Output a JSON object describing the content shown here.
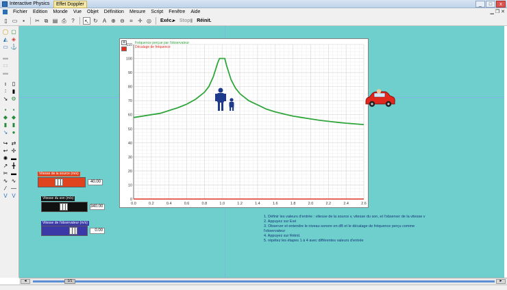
{
  "window": {
    "title": "Interactive Physics",
    "document": "Effet Doppler",
    "controls": [
      "_",
      "□",
      "x"
    ]
  },
  "menu": {
    "items": [
      "Fichier",
      "Edition",
      "Monde",
      "Vue",
      "Objet",
      "Définition",
      "Mesure",
      "Script",
      "Fenêtre",
      "Aide"
    ]
  },
  "toolbar": {
    "run_label": "Exéc.▸",
    "stop_label": "Stop▮",
    "reset_label": "Réinit."
  },
  "graph": {
    "legend_received": "Fréquence perçue par l'observateur",
    "legend_shift": "Décalage de fréquence",
    "colors": {
      "received": "#2fa53a",
      "shift": "#e03020"
    }
  },
  "chart_data": {
    "type": "line",
    "xlim": [
      0.0,
      2.6
    ],
    "ylim": [
      0,
      110
    ],
    "x_ticks": [
      "0.0",
      "0.2",
      "0.4",
      "0.6",
      "0.8",
      "1.0",
      "1.2",
      "1.4",
      "1.6",
      "1.8",
      "2.0",
      "2.2",
      "2.4",
      "2.6"
    ],
    "y_ticks": [
      "0",
      "10",
      "20",
      "30",
      "40",
      "50",
      "60",
      "70",
      "80",
      "90",
      "100",
      "110"
    ],
    "series": [
      {
        "name": "Fréquence perçue par l'observateur",
        "color": "#2fa53a",
        "x": [
          0.0,
          0.1,
          0.2,
          0.3,
          0.4,
          0.5,
          0.6,
          0.7,
          0.8,
          0.85,
          0.9,
          0.95,
          0.97,
          1.0,
          1.03,
          1.05,
          1.1,
          1.15,
          1.2,
          1.3,
          1.4,
          1.5,
          1.6,
          1.7,
          1.8,
          1.9,
          2.0,
          2.1,
          2.2,
          2.3,
          2.4,
          2.5,
          2.6
        ],
        "y": [
          58,
          59,
          60,
          61,
          63,
          65,
          67.5,
          71,
          76,
          80,
          87,
          97,
          100,
          100,
          100,
          95,
          85,
          79,
          75,
          70,
          67,
          64,
          62,
          60.5,
          59,
          58,
          57,
          56,
          55.3,
          54.6,
          54,
          53.5,
          53
        ]
      },
      {
        "name": "Décalage de fréquence",
        "color": "#e03020",
        "x": [
          0.0,
          2.6
        ],
        "y": [
          0,
          0
        ]
      }
    ]
  },
  "controls": [
    {
      "label": "Vitesse de la source (m/s)",
      "value": "40.00",
      "color": "#e0441f",
      "knob": 0.45
    },
    {
      "label": "Vitesse du son (m/s)",
      "value": "340.00",
      "color": "#111111",
      "knob": 0.5
    },
    {
      "label": "Vitesse de l'observateur (m/s)",
      "value": "0.00",
      "color": "#3b39a8",
      "knob": 0.77
    }
  ],
  "instructions": [
    "1. Définir les valeurs d'entrée : vitesse de la source v, vitesse du son, et l'observer de la vitesse v",
    "2. Appuyez sur Exé",
    "3. Observer et entendre le niveau sonore en dB et le décalage de fréquence perçu comme",
    "l'observateur",
    "4. Appuyez sur Réinit.",
    "5. répétez les étapes 1 à 4 avec différentes valeurs d'entrée"
  ],
  "scrollbar": {
    "thumb_label": "1/1"
  }
}
